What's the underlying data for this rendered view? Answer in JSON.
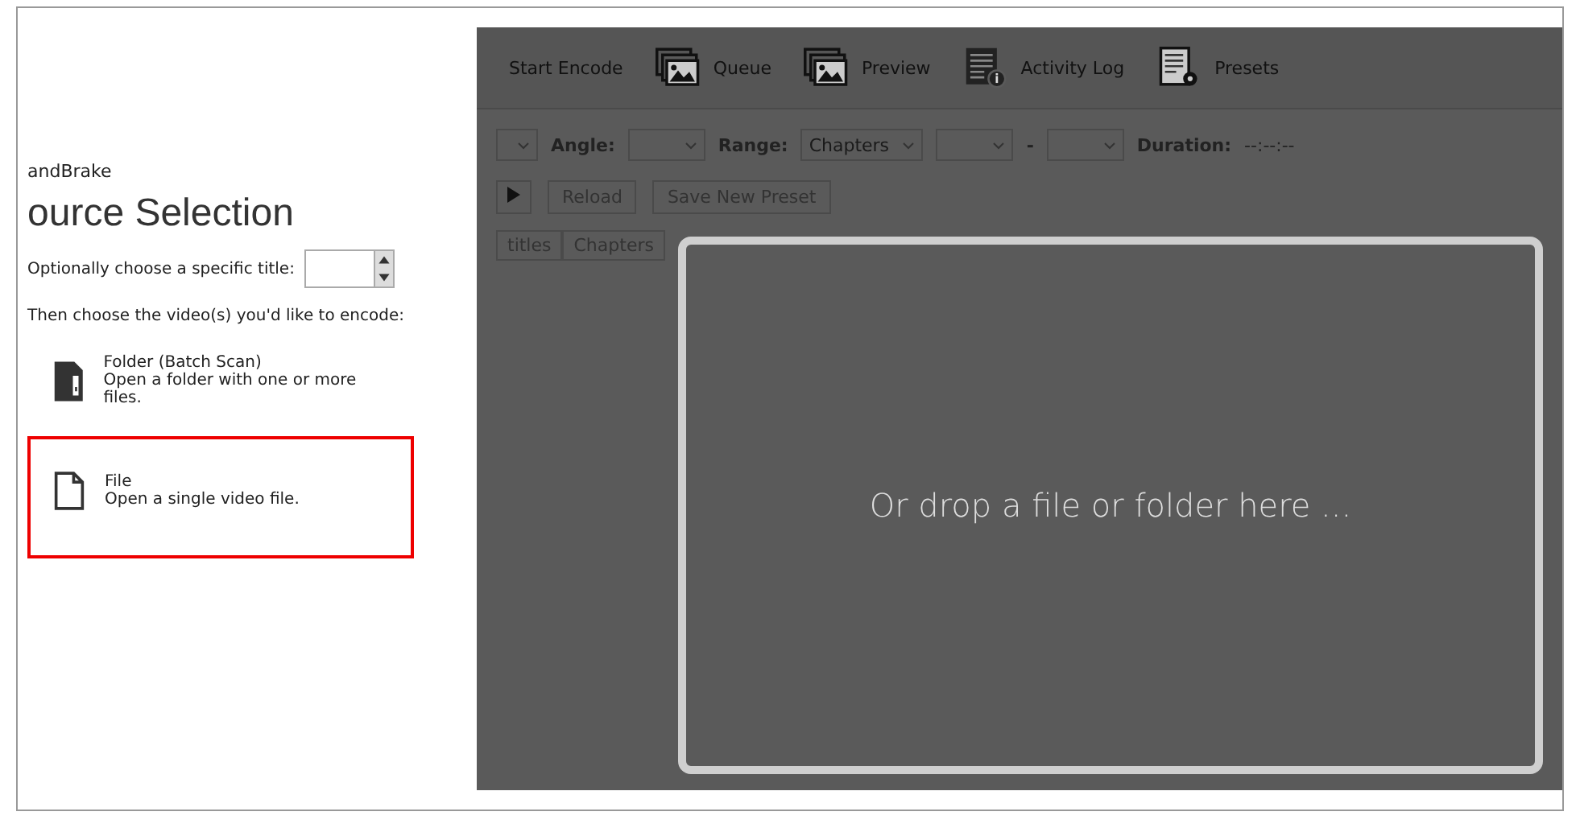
{
  "app_title": "andBrake",
  "source_panel": {
    "heading": "ource Selection",
    "title_prompt": "Optionally choose a specific title:",
    "encode_prompt": "Then choose the video(s) you'd like to encode:",
    "options": [
      {
        "kind": "folder",
        "title": "Folder (Batch Scan)",
        "description": "Open a folder with one or more files.",
        "highlighted": false
      },
      {
        "kind": "file",
        "title": "File",
        "description": "Open a single video file.",
        "highlighted": true
      }
    ]
  },
  "toolbar": [
    {
      "kind": "start",
      "label": "Start Encode"
    },
    {
      "kind": "queue",
      "label": "Queue"
    },
    {
      "kind": "preview",
      "label": "Preview"
    },
    {
      "kind": "log",
      "label": "Activity Log"
    },
    {
      "kind": "presets",
      "label": "Presets"
    }
  ],
  "range_row": {
    "angle_label": "Angle:",
    "range_label": "Range:",
    "range_value": "Chapters",
    "separator": "-",
    "duration_label": "Duration:",
    "duration_value": "--:--:--"
  },
  "buttons": [
    "Reload",
    "Save New Preset"
  ],
  "tabs": [
    {
      "label": "titles",
      "selected": false
    },
    {
      "label": "Chapters",
      "selected": false
    }
  ],
  "drop_zone": {
    "text": "Or drop a file or folder here ..."
  }
}
